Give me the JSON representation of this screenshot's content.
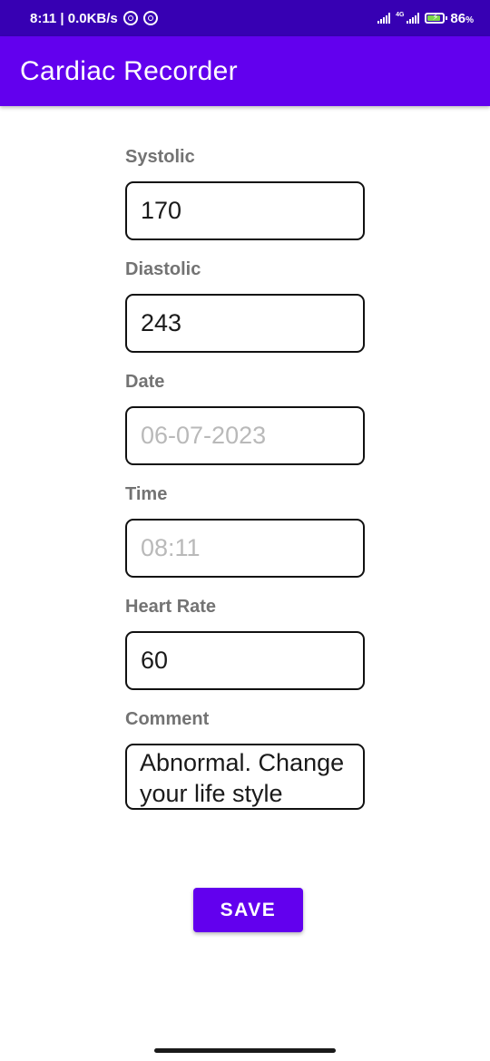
{
  "status_bar": {
    "time_speed": "8:11 | 0.0KB/s",
    "network_tag": "4G",
    "battery_percent": "86",
    "battery_unit": "%",
    "battery_level": 0.86,
    "icons": [
      "location-icon",
      "sync-icon",
      "signal-icon",
      "signal-4g-icon",
      "battery-charging-icon"
    ]
  },
  "app_bar": {
    "title": "Cardiac Recorder"
  },
  "form": {
    "systolic": {
      "label": "Systolic",
      "value": "170",
      "placeholder": ""
    },
    "diastolic": {
      "label": "Diastolic",
      "value": "243",
      "placeholder": ""
    },
    "date": {
      "label": "Date",
      "value": "",
      "placeholder": "06-07-2023"
    },
    "time": {
      "label": "Time",
      "value": "",
      "placeholder": "08:11"
    },
    "heart_rate": {
      "label": "Heart Rate",
      "value": "60",
      "placeholder": ""
    },
    "comment": {
      "label": "Comment",
      "value": "Abnormal. Change your life style"
    }
  },
  "actions": {
    "save_label": "SAVE"
  },
  "colors": {
    "status_bar": "#3700b3",
    "primary": "#6200ee",
    "label": "#737373",
    "placeholder": "#b9b9b9"
  }
}
